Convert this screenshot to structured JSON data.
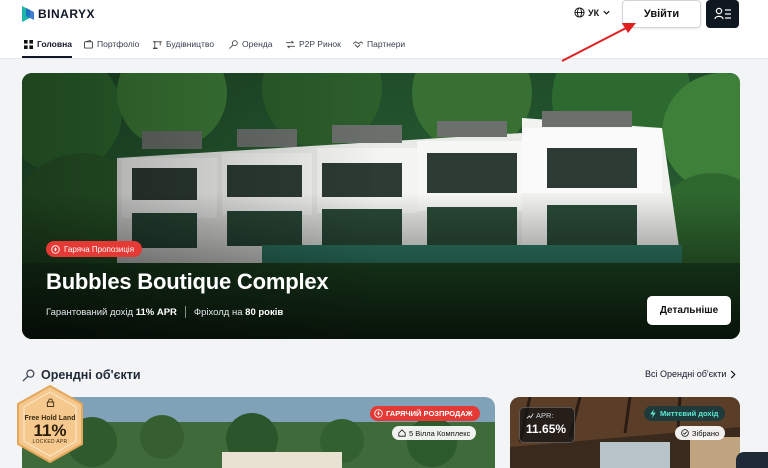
{
  "header": {
    "logo_text": "BINARYX",
    "language": "УК",
    "login_label": "Увійти",
    "logo_icon": "binaryx-logo-icon",
    "globe_icon": "globe-icon",
    "profile_icon": "user-menu-icon"
  },
  "nav": {
    "items": [
      {
        "label": "Головна",
        "icon": "grid-icon",
        "active": true
      },
      {
        "label": "Портфоліо",
        "icon": "wallet-icon"
      },
      {
        "label": "Будівництво",
        "icon": "crane-icon"
      },
      {
        "label": "Оренда",
        "icon": "key-icon"
      },
      {
        "label": "P2P Ринок",
        "icon": "swap-icon"
      },
      {
        "label": "Партнери",
        "icon": "handshake-icon"
      }
    ]
  },
  "hero": {
    "badge": "Гаряча Пропозиція",
    "title": "Bubbles Boutique Complex",
    "income_label": "Гарантований дохід",
    "income_value": "11% APR",
    "freehold_label": "Фріхолд на",
    "freehold_value": "80 років",
    "details_label": "Детальніше"
  },
  "rentals": {
    "title": "Орендні об'єкти",
    "see_all": "Всі Орендні об'єкти",
    "cards": [
      {
        "hex_title": "Free Hold Land",
        "hex_value": "11%",
        "hex_sub": "LOCKED APR",
        "sale_badge": "ГАРЯЧИЙ РОЗПРОДАЖ",
        "type_badge": "5 Вілла Комплекс"
      },
      {
        "apr_label": "APR:",
        "apr_value": "11.65%",
        "instant_badge": "Миттєвий дохід",
        "status_badge": "Зібрано"
      }
    ]
  },
  "colors": {
    "accent_dark": "#0f1720",
    "hot_red": "#e53935",
    "instant_teal": "#5eead4",
    "hex_gold": "#f3c98a",
    "annotation_arrow": "#e02020"
  }
}
